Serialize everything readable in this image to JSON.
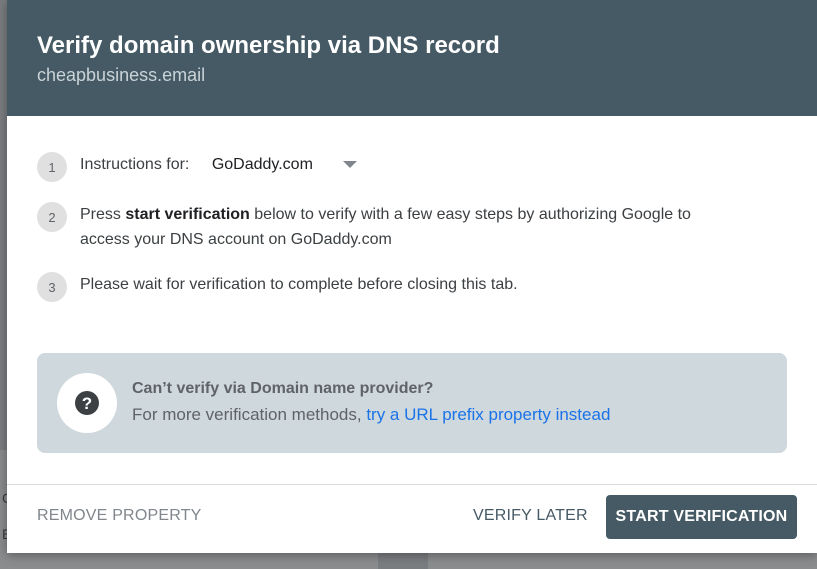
{
  "dialog": {
    "title": "Verify domain ownership via DNS record",
    "subtitle": "cheapbusiness.email"
  },
  "steps": [
    {
      "number": "1",
      "label": "Instructions for:",
      "select_value": "GoDaddy.com"
    },
    {
      "number": "2",
      "text_prefix": "Press ",
      "text_bold": "start verification",
      "text_suffix": " below to verify with a few easy steps by authorizing Google to access your DNS account on GoDaddy.com"
    },
    {
      "number": "3",
      "text": "Please wait for verification to complete before closing this tab."
    }
  ],
  "info": {
    "icon": "help-icon",
    "title": "Can’t verify via Domain name provider?",
    "desc_prefix": "For more verification methods, ",
    "link_text": "try a URL prefix property instead"
  },
  "footer": {
    "remove_label": "REMOVE PROPERTY",
    "later_label": "VERIFY LATER",
    "start_label": "START VERIFICATION"
  },
  "background": {
    "letter_1": "C",
    "letter_2": "E"
  },
  "colors": {
    "header_bg": "#455a64",
    "link": "#1a73e8",
    "info_bg": "#cfd8dc",
    "primary_button": "#455a64"
  }
}
